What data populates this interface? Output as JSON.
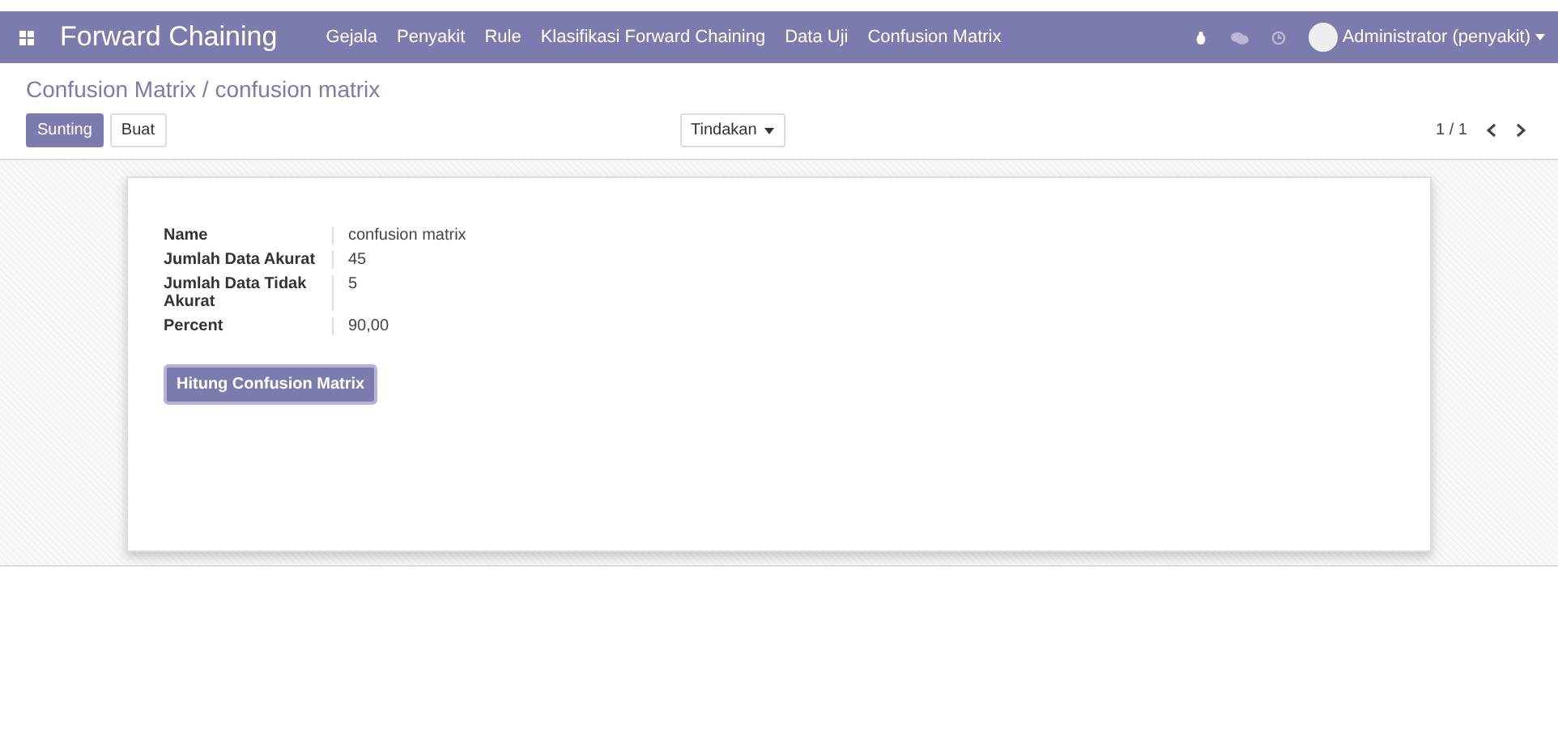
{
  "navbar": {
    "app_title": "Forward Chaining",
    "menu": [
      {
        "label": "Gejala"
      },
      {
        "label": "Penyakit"
      },
      {
        "label": "Rule"
      },
      {
        "label": "Klasifikasi Forward Chaining"
      },
      {
        "label": "Data Uji"
      },
      {
        "label": "Confusion Matrix"
      }
    ],
    "user": "Administrator (penyakit)"
  },
  "breadcrumb": "Confusion Matrix / confusion matrix",
  "buttons": {
    "edit": "Sunting",
    "create": "Buat",
    "action": "Tindakan",
    "pager": "1 / 1"
  },
  "form": {
    "fields": [
      {
        "label": "Name",
        "value": "confusion matrix"
      },
      {
        "label": "Jumlah Data Akurat",
        "value": "45"
      },
      {
        "label": "Jumlah Data Tidak Akurat",
        "value": "5"
      },
      {
        "label": "Percent",
        "value": "90,00"
      }
    ],
    "button": "Hitung Confusion Matrix"
  }
}
